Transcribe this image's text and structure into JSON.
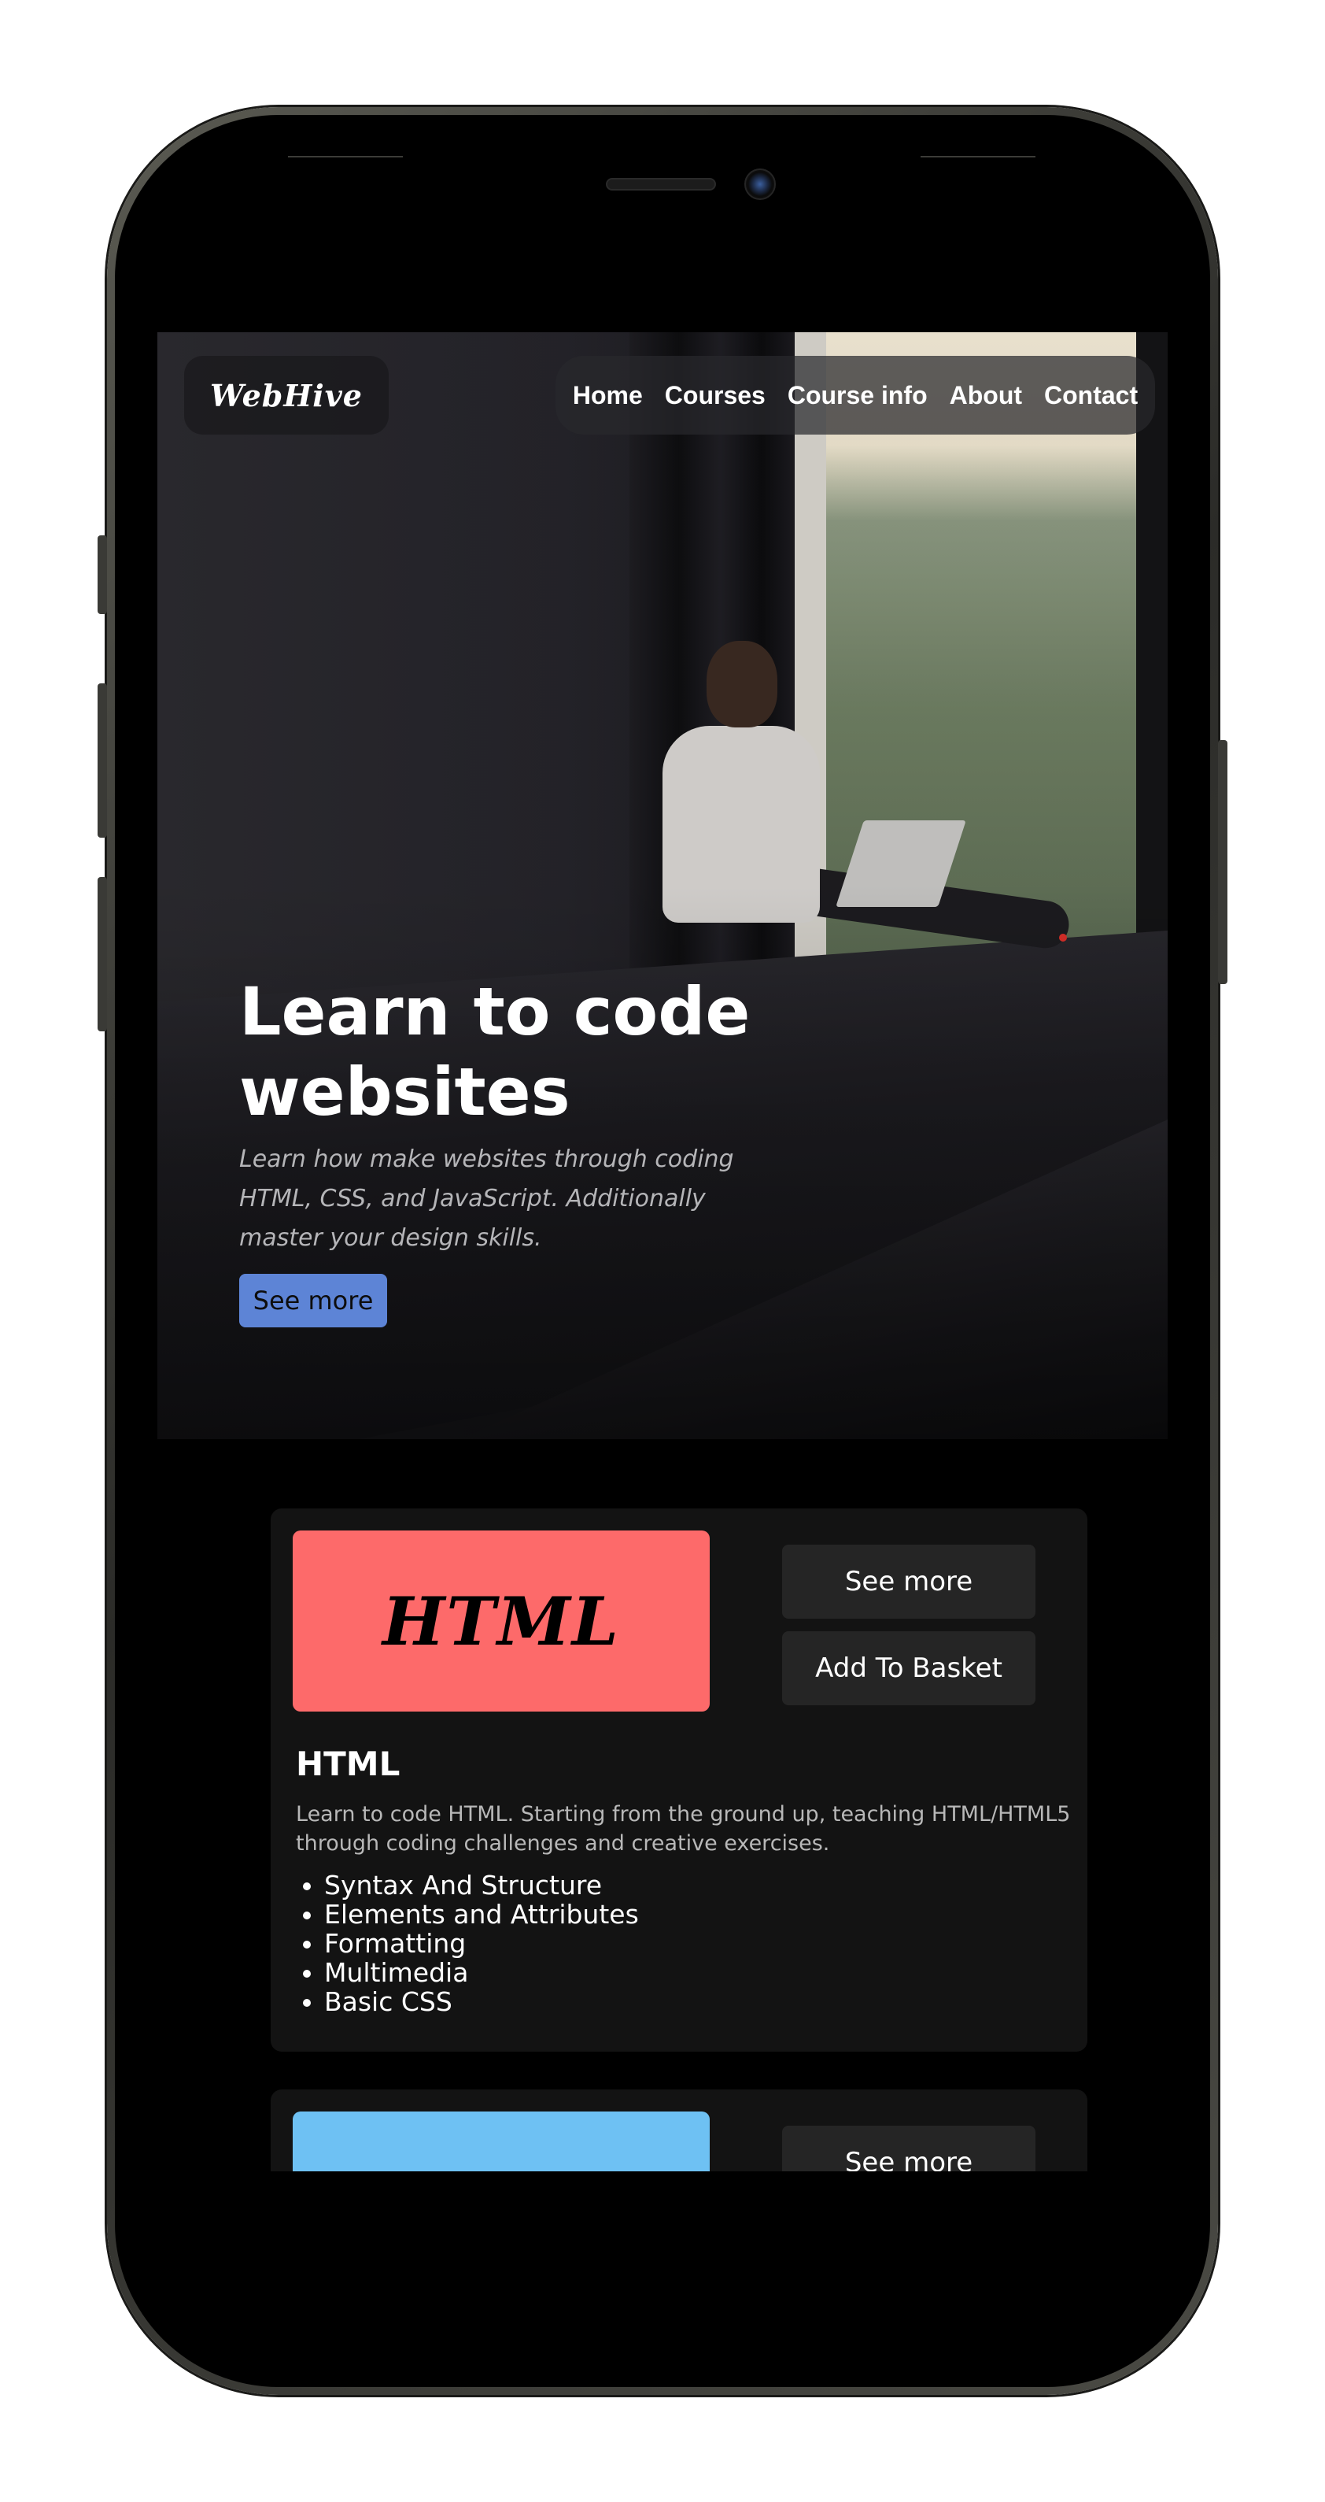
{
  "brand": {
    "logo": "WebHive"
  },
  "nav": {
    "items": [
      {
        "label": "Home"
      },
      {
        "label": "Courses"
      },
      {
        "label": "Course info"
      },
      {
        "label": "About"
      },
      {
        "label": "Contact"
      }
    ]
  },
  "hero": {
    "title": "Learn to code websites",
    "description": "Learn how make websites through coding HTML, CSS, and JavaScript. Additionally master your design skills.",
    "button_label": "See more",
    "button_color": "#5d84d6"
  },
  "courses": [
    {
      "banner_text": "HTML",
      "banner_color": "#fd6a6a",
      "see_more_label": "See more",
      "add_to_basket_label": "Add To Basket",
      "title": "HTML",
      "description": "Learn to code HTML. Starting from the ground up, teaching HTML/HTML5 through coding challenges and creative exercises.",
      "topics": [
        "Syntax And Structure",
        "Elements and Attributes",
        "Formatting",
        "Multimedia",
        "Basic CSS"
      ]
    },
    {
      "banner_color": "#6ec1f3",
      "see_more_label": "See more"
    }
  ],
  "theme": {
    "page_background": "#000000",
    "card_background": "#131313",
    "button_background": "#252525"
  }
}
